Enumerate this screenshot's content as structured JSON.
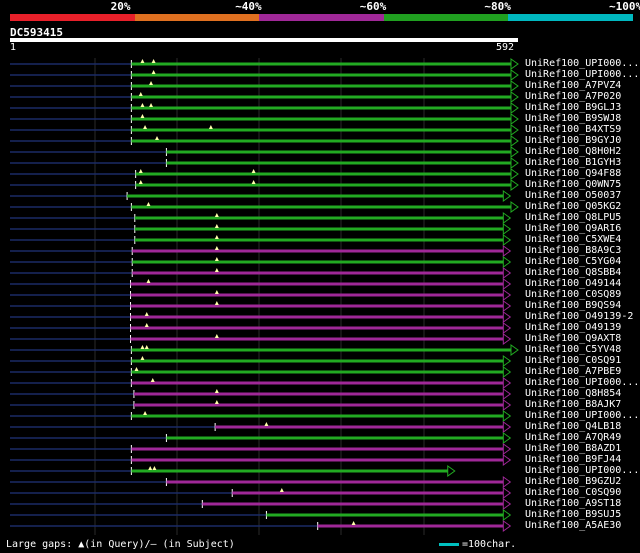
{
  "identity_scale": [
    {
      "label": "20%",
      "color": "#e8202a"
    },
    {
      "label": "~40%",
      "color": "#e07020"
    },
    {
      "label": "~60%",
      "color": "#a02898"
    },
    {
      "label": "~80%",
      "color": "#20a020"
    },
    {
      "label": "~100%",
      "color": "#00b8c0"
    }
  ],
  "query": {
    "name": "DC593415",
    "start": "1",
    "end": "592",
    "length": 592
  },
  "hits": [
    {
      "label": "UniRef100_UPI000...",
      "color": "#22aa22",
      "start": 142,
      "end": 592,
      "gaps": [
        155,
        168
      ]
    },
    {
      "label": "UniRef100_UPI000...",
      "color": "#22aa22",
      "start": 142,
      "end": 592,
      "gaps": [
        168
      ]
    },
    {
      "label": "UniRef100_A7PVZ4",
      "color": "#22aa22",
      "start": 142,
      "end": 592,
      "gaps": [
        165
      ]
    },
    {
      "label": "UniRef100_A7P020",
      "color": "#22aa22",
      "start": 142,
      "end": 592,
      "gaps": [
        153
      ]
    },
    {
      "label": "UniRef100_B9GLJ3",
      "color": "#22aa22",
      "start": 142,
      "end": 592,
      "gaps": [
        155,
        165
      ]
    },
    {
      "label": "UniRef100_B9SWJ8",
      "color": "#22aa22",
      "start": 142,
      "end": 592,
      "gaps": [
        155
      ]
    },
    {
      "label": "UniRef100_B4XTS9",
      "color": "#22aa22",
      "start": 142,
      "end": 592,
      "gaps": [
        158,
        235
      ]
    },
    {
      "label": "UniRef100_B9GYJ0",
      "color": "#22aa22",
      "start": 142,
      "end": 592,
      "gaps": [
        172
      ]
    },
    {
      "label": "UniRef100_Q8H0H2",
      "color": "#22aa22",
      "start": 183,
      "end": 592,
      "gaps": []
    },
    {
      "label": "UniRef100_B1GYH3",
      "color": "#22aa22",
      "start": 183,
      "end": 592,
      "gaps": []
    },
    {
      "label": "UniRef100_Q94F88",
      "color": "#22aa22",
      "start": 147,
      "end": 592,
      "gaps": [
        153,
        285
      ]
    },
    {
      "label": "UniRef100_Q0WN75",
      "color": "#22aa22",
      "start": 147,
      "end": 592,
      "gaps": [
        153,
        285
      ]
    },
    {
      "label": "UniRef100_O50037",
      "color": "#22aa22",
      "start": 137,
      "end": 583,
      "gaps": []
    },
    {
      "label": "UniRef100_Q05KG2",
      "color": "#22aa22",
      "start": 142,
      "end": 592,
      "gaps": [
        162
      ]
    },
    {
      "label": "UniRef100_Q8LPU5",
      "color": "#22aa22",
      "start": 146,
      "end": 583,
      "gaps": [
        242
      ]
    },
    {
      "label": "UniRef100_Q9ARI6",
      "color": "#22aa22",
      "start": 146,
      "end": 583,
      "gaps": [
        242
      ]
    },
    {
      "label": "UniRef100_C5XWE4",
      "color": "#22aa22",
      "start": 146,
      "end": 583,
      "gaps": [
        242
      ]
    },
    {
      "label": "UniRef100_B8A9C3",
      "color": "#a02898",
      "start": 143,
      "end": 583,
      "gaps": [
        242
      ]
    },
    {
      "label": "UniRef100_C5YG04",
      "color": "#22aa22",
      "start": 143,
      "end": 583,
      "gaps": [
        242
      ]
    },
    {
      "label": "UniRef100_Q8SBB4",
      "color": "#a02898",
      "start": 143,
      "end": 583,
      "gaps": [
        242
      ]
    },
    {
      "label": "UniRef100_O49144",
      "color": "#a02898",
      "start": 141,
      "end": 583,
      "gaps": [
        162
      ]
    },
    {
      "label": "UniRef100_C0SQ89",
      "color": "#a02898",
      "start": 141,
      "end": 583,
      "gaps": [
        242
      ]
    },
    {
      "label": "UniRef100_B9QS94",
      "color": "#a02898",
      "start": 141,
      "end": 583,
      "gaps": [
        242
      ]
    },
    {
      "label": "UniRef100_O49139-2",
      "color": "#a02898",
      "start": 141,
      "end": 583,
      "gaps": [
        160
      ]
    },
    {
      "label": "UniRef100_O49139",
      "color": "#a02898",
      "start": 141,
      "end": 583,
      "gaps": [
        160
      ]
    },
    {
      "label": "UniRef100_Q9AXT8",
      "color": "#a02898",
      "start": 141,
      "end": 583,
      "gaps": [
        242
      ]
    },
    {
      "label": "UniRef100_C5YV48",
      "color": "#22aa22",
      "start": 142,
      "end": 592,
      "gaps": [
        155,
        160
      ]
    },
    {
      "label": "UniRef100_C0SQ91",
      "color": "#22aa22",
      "start": 142,
      "end": 583,
      "gaps": [
        155
      ]
    },
    {
      "label": "UniRef100_A7PBE9",
      "color": "#22aa22",
      "start": 142,
      "end": 583,
      "gaps": [
        148
      ]
    },
    {
      "label": "UniRef100_UPI000...",
      "color": "#a02898",
      "start": 142,
      "end": 583,
      "gaps": [
        167
      ]
    },
    {
      "label": "UniRef100_Q8H854",
      "color": "#a02898",
      "start": 145,
      "end": 583,
      "gaps": [
        242
      ]
    },
    {
      "label": "UniRef100_B8AJK7",
      "color": "#a02898",
      "start": 145,
      "end": 583,
      "gaps": [
        242
      ]
    },
    {
      "label": "UniRef100_UPI000...",
      "color": "#22aa22",
      "start": 142,
      "end": 583,
      "gaps": [
        158
      ]
    },
    {
      "label": "UniRef100_Q4LB18",
      "color": "#a02898",
      "start": 240,
      "end": 583,
      "gaps": [
        300
      ]
    },
    {
      "label": "UniRef100_A7QR49",
      "color": "#22aa22",
      "start": 183,
      "end": 583,
      "gaps": []
    },
    {
      "label": "UniRef100_B8AZD1",
      "color": "#a02898",
      "start": 142,
      "end": 583,
      "gaps": []
    },
    {
      "label": "UniRef100_B9FJ44",
      "color": "#a02898",
      "start": 142,
      "end": 583,
      "gaps": []
    },
    {
      "label": "UniRef100_UPI000...",
      "color": "#22aa22",
      "start": 142,
      "end": 518,
      "gaps": [
        164,
        169
      ]
    },
    {
      "label": "UniRef100_B9GZU2",
      "color": "#a02898",
      "start": 183,
      "end": 583,
      "gaps": []
    },
    {
      "label": "UniRef100_C0SQ90",
      "color": "#a02898",
      "start": 260,
      "end": 583,
      "gaps": [
        318
      ]
    },
    {
      "label": "UniRef100_A9ST18",
      "color": "#a02898",
      "start": 225,
      "end": 583,
      "gaps": []
    },
    {
      "label": "UniRef100_B9SUJ5",
      "color": "#22aa22",
      "start": 300,
      "end": 583,
      "gaps": []
    },
    {
      "label": "UniRef100_A5AE30",
      "color": "#a02898",
      "start": 360,
      "end": 583,
      "gaps": [
        402
      ]
    }
  ],
  "footer": {
    "gap_legend": "Large gaps: ▲(in Query)/– (in Subject)",
    "scale_legend": "=100char."
  }
}
